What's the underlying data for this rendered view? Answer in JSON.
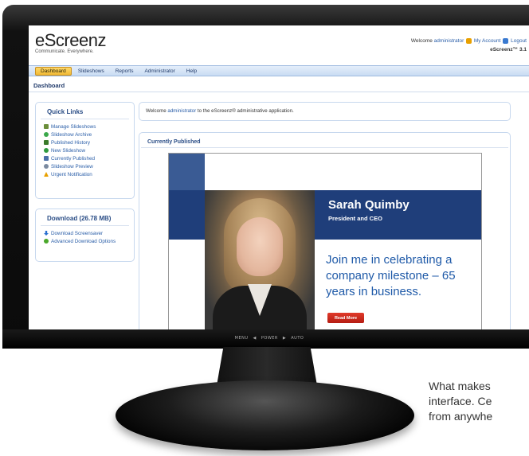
{
  "app": {
    "logo": "eScreenz",
    "tagline": "Communicate. Everywhere.",
    "welcome_prefix": "Welcome",
    "user": "administrator",
    "my_account": "My Account",
    "logout": "Logout",
    "version": "eScreenz™ 3.1"
  },
  "nav": {
    "tabs": [
      "Dashboard",
      "Slideshows",
      "Reports",
      "Administrator",
      "Help"
    ],
    "active": "Dashboard"
  },
  "page": {
    "title": "Dashboard"
  },
  "quick_links": {
    "title": "Quick Links",
    "items": [
      {
        "label": "Manage Slideshows",
        "icon": "slideshow-icon",
        "color": "#6b8e3a"
      },
      {
        "label": "Slideshow Archive",
        "icon": "archive-icon",
        "color": "#3aa84a"
      },
      {
        "label": "Published History",
        "icon": "history-icon",
        "color": "#3a7a2a"
      },
      {
        "label": "New Slideshow",
        "icon": "add-icon",
        "color": "#2e9a3e"
      },
      {
        "label": "Currently Published",
        "icon": "published-icon",
        "color": "#4a6fa8"
      },
      {
        "label": "Slideshow Preview",
        "icon": "preview-icon",
        "color": "#7a8aa0"
      },
      {
        "label": "Urgent Notification",
        "icon": "warning-icon",
        "color": "#e8a000"
      }
    ]
  },
  "download": {
    "title": "Download (26.78 MB)",
    "items": [
      {
        "label": "Download Screensaver",
        "icon": "download-icon",
        "color": "#2a6fd0"
      },
      {
        "label": "Advanced Download Options",
        "icon": "options-icon",
        "color": "#4aa82a"
      }
    ]
  },
  "welcome_panel": {
    "prefix": "Welcome",
    "user": "administrator",
    "suffix": "to the eScreenz® administrative application."
  },
  "currently_published": {
    "title": "Currently Published",
    "slide": {
      "name": "Sarah Quimby",
      "role": "President and CEO",
      "message": "Join me in celebrating a company milestone – 65 years in business.",
      "button": "Read More"
    }
  },
  "monitor": {
    "controls": [
      "MENU",
      "◀",
      "POWER",
      "▶",
      "AUTO"
    ]
  },
  "caption": {
    "lines": [
      "What makes",
      "interface. Ce",
      "from anywhe"
    ]
  },
  "colors": {
    "accent": "#2a4d86",
    "nav_active": "#f1b934",
    "slide_band": "#1f3e7a",
    "button_red": "#c62a1c"
  }
}
